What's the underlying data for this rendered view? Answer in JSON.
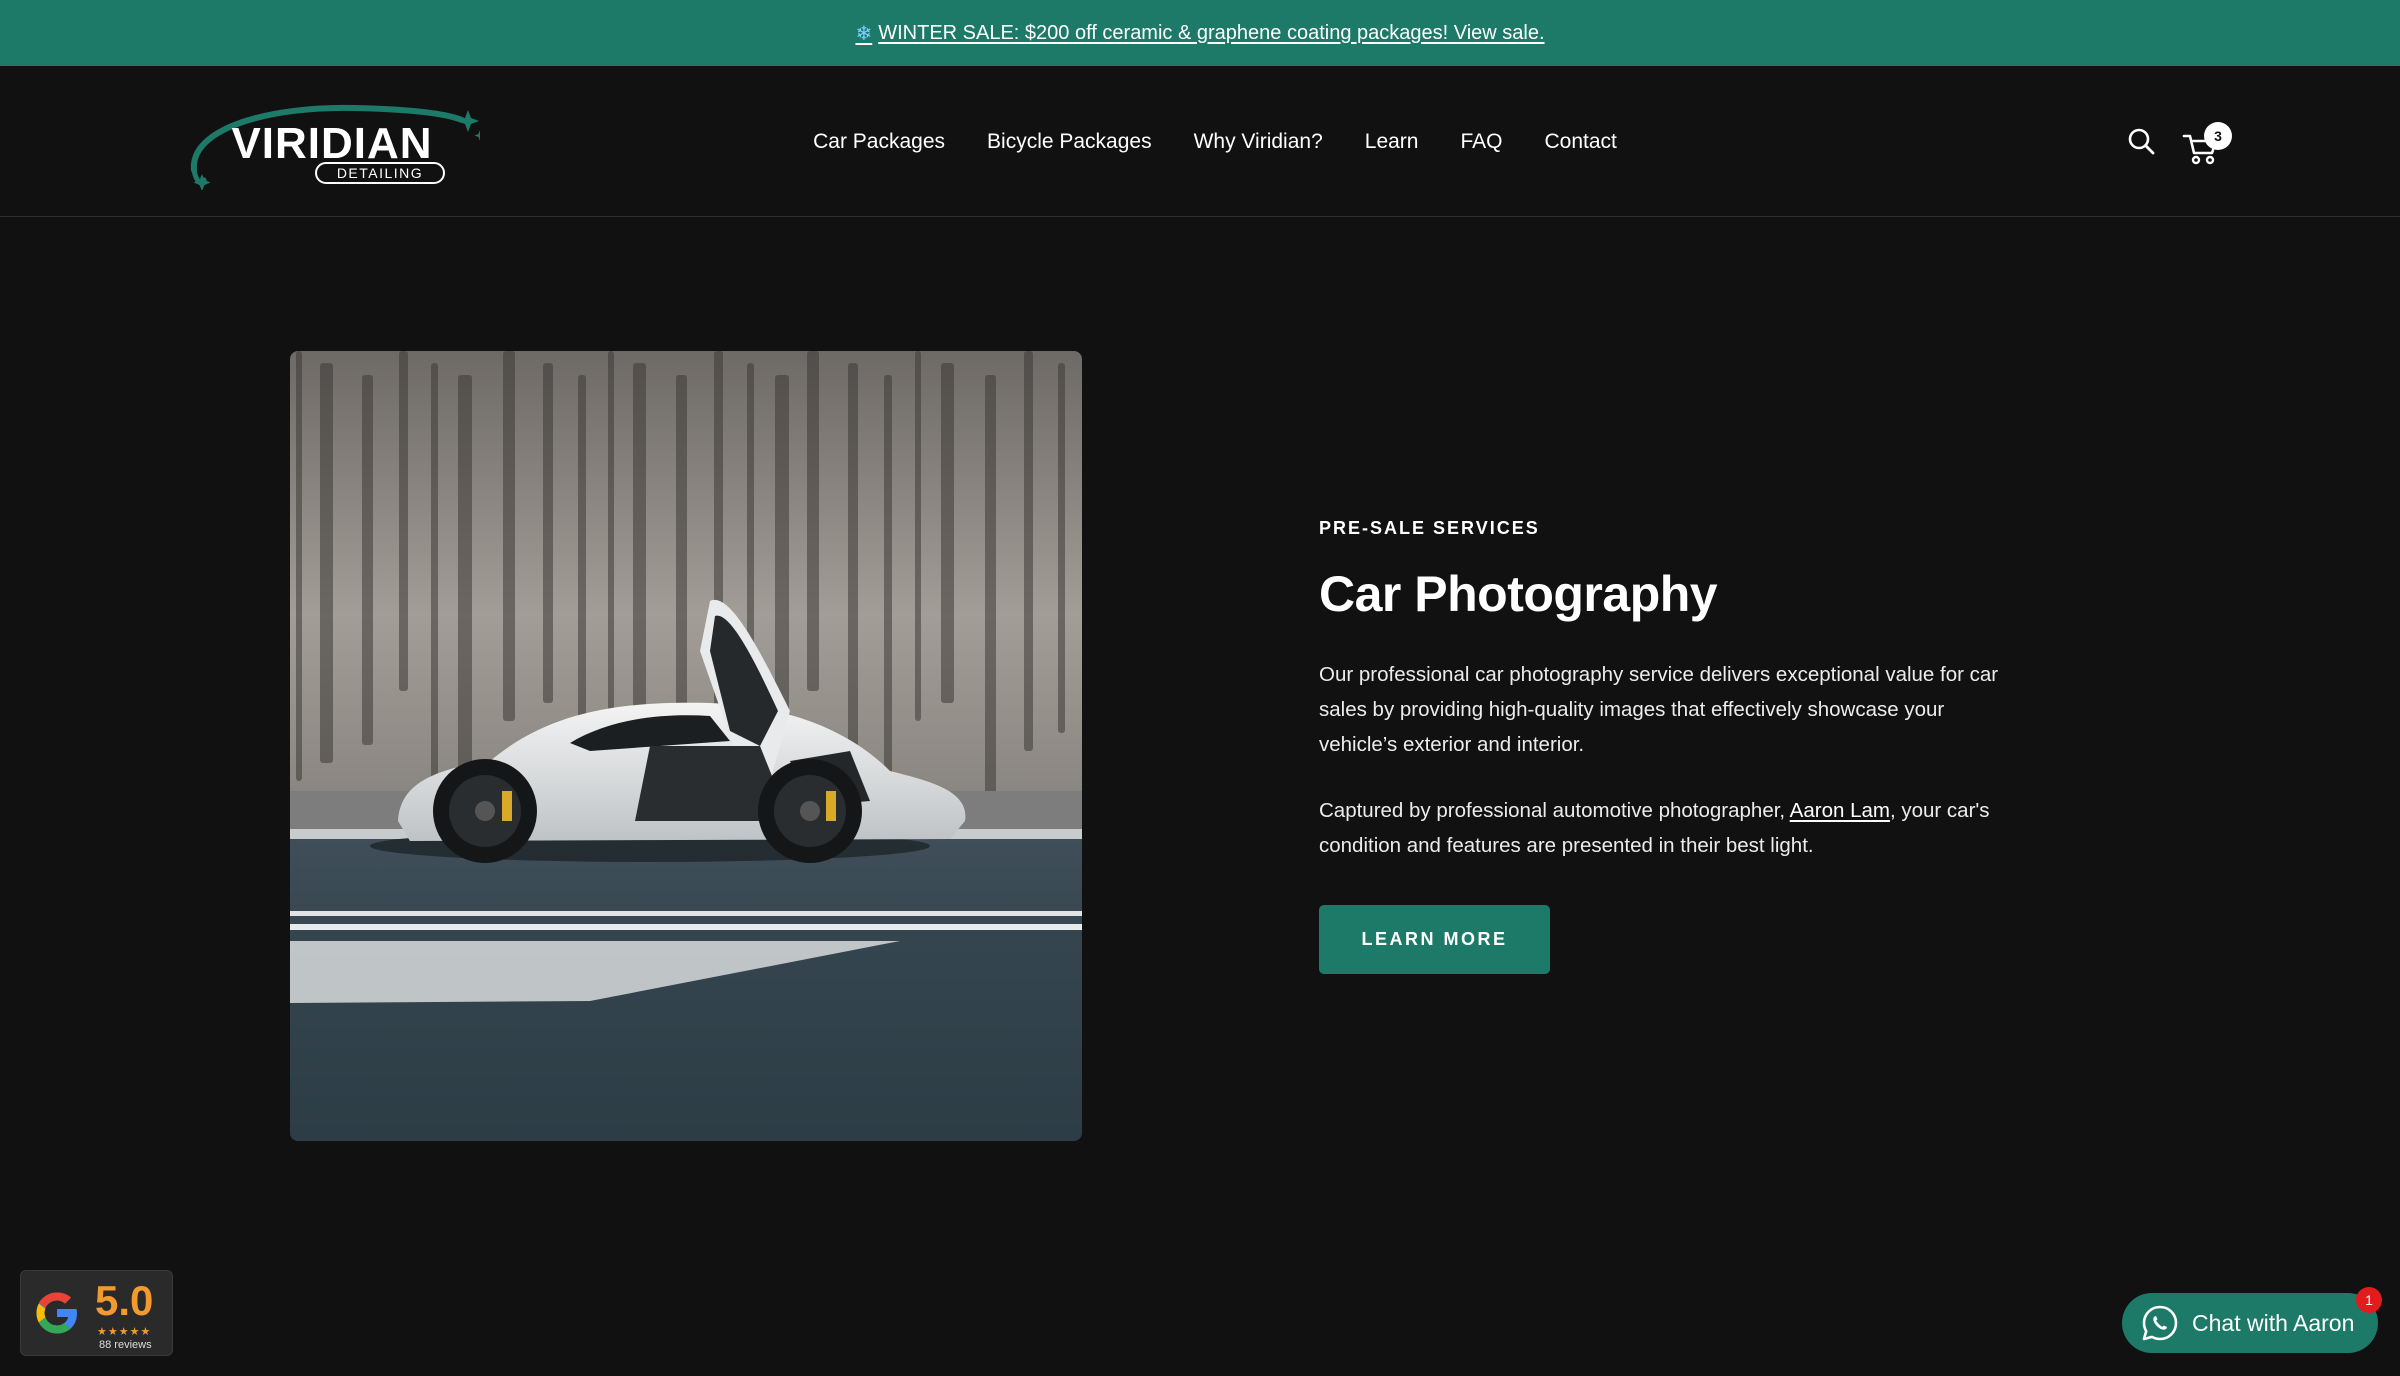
{
  "announcement": {
    "icon": "snowflake-icon",
    "text": "WINTER SALE: $200 off ceramic & graphene coating packages! View sale."
  },
  "header": {
    "logo": {
      "brand": "VIRIDIAN",
      "sub": "DETAILING"
    },
    "nav": [
      {
        "label": "Car Packages"
      },
      {
        "label": "Bicycle Packages"
      },
      {
        "label": "Why Viridian?"
      },
      {
        "label": "Learn"
      },
      {
        "label": "FAQ"
      },
      {
        "label": "Contact"
      }
    ],
    "cart_count": "3"
  },
  "section": {
    "kicker": "PRE-SALE SERVICES",
    "title": "Car Photography",
    "paragraph1": "Our professional car photography service delivers exceptional value for car sales by providing high-quality images that effectively showcase your vehicle’s exterior and interior.",
    "paragraph2_before": "Captured by professional automotive photographer, ",
    "paragraph2_link": "Aaron Lam",
    "paragraph2_after": ", your car's condition and features are presented in their best light.",
    "button": "LEARN MORE"
  },
  "google_badge": {
    "score": "5.0",
    "stars": "★★★★★",
    "reviews": "88 reviews"
  },
  "chat": {
    "label": "Chat with Aaron",
    "badge": "1"
  },
  "colors": {
    "brand_green": "#1e7a68",
    "background": "#111112",
    "rating_orange": "#f29a2e",
    "notification_red": "#e21c1c"
  }
}
